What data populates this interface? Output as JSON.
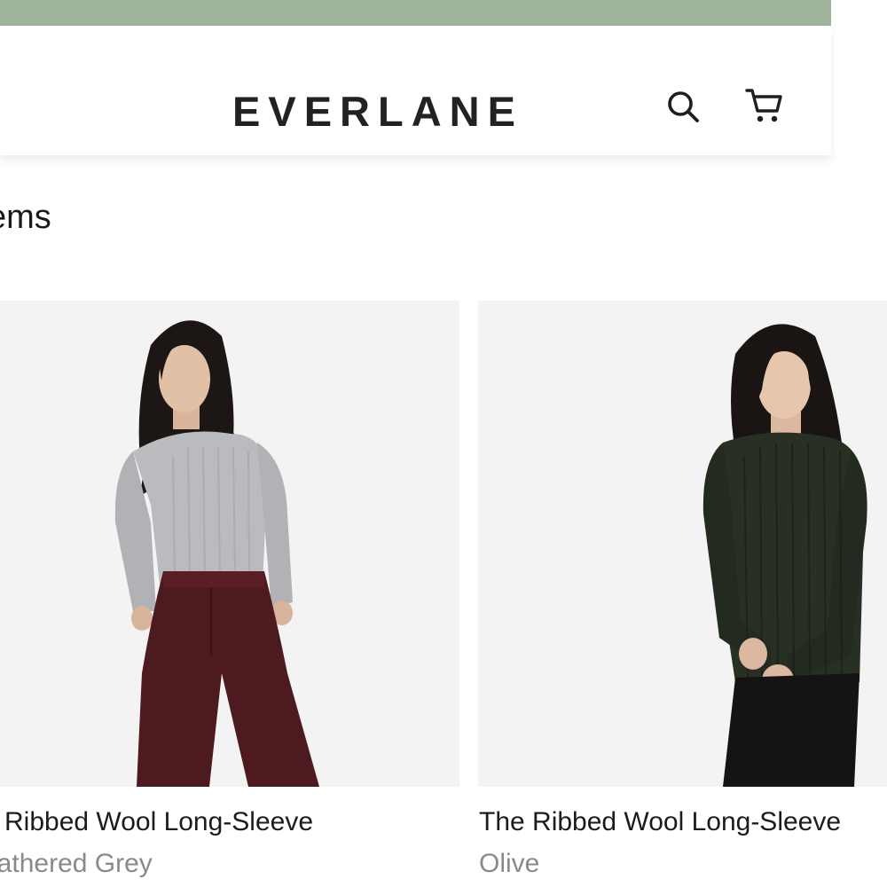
{
  "header": {
    "logo": "EVERLANE",
    "icons": {
      "search": "search-icon",
      "cart": "cart-icon"
    }
  },
  "colors": {
    "promo_strip": "#9fb39a",
    "header_bg": "#ffffff",
    "product_bg": "#f3f3f3",
    "secondary_text": "#8a8a8a"
  },
  "listing": {
    "item_count_text": "ems"
  },
  "products": [
    {
      "name": "e Ribbed Wool Long-Sleeve",
      "color": "eathered Grey"
    },
    {
      "name": "The Ribbed Wool Long-Sleeve",
      "color": "Olive"
    }
  ]
}
